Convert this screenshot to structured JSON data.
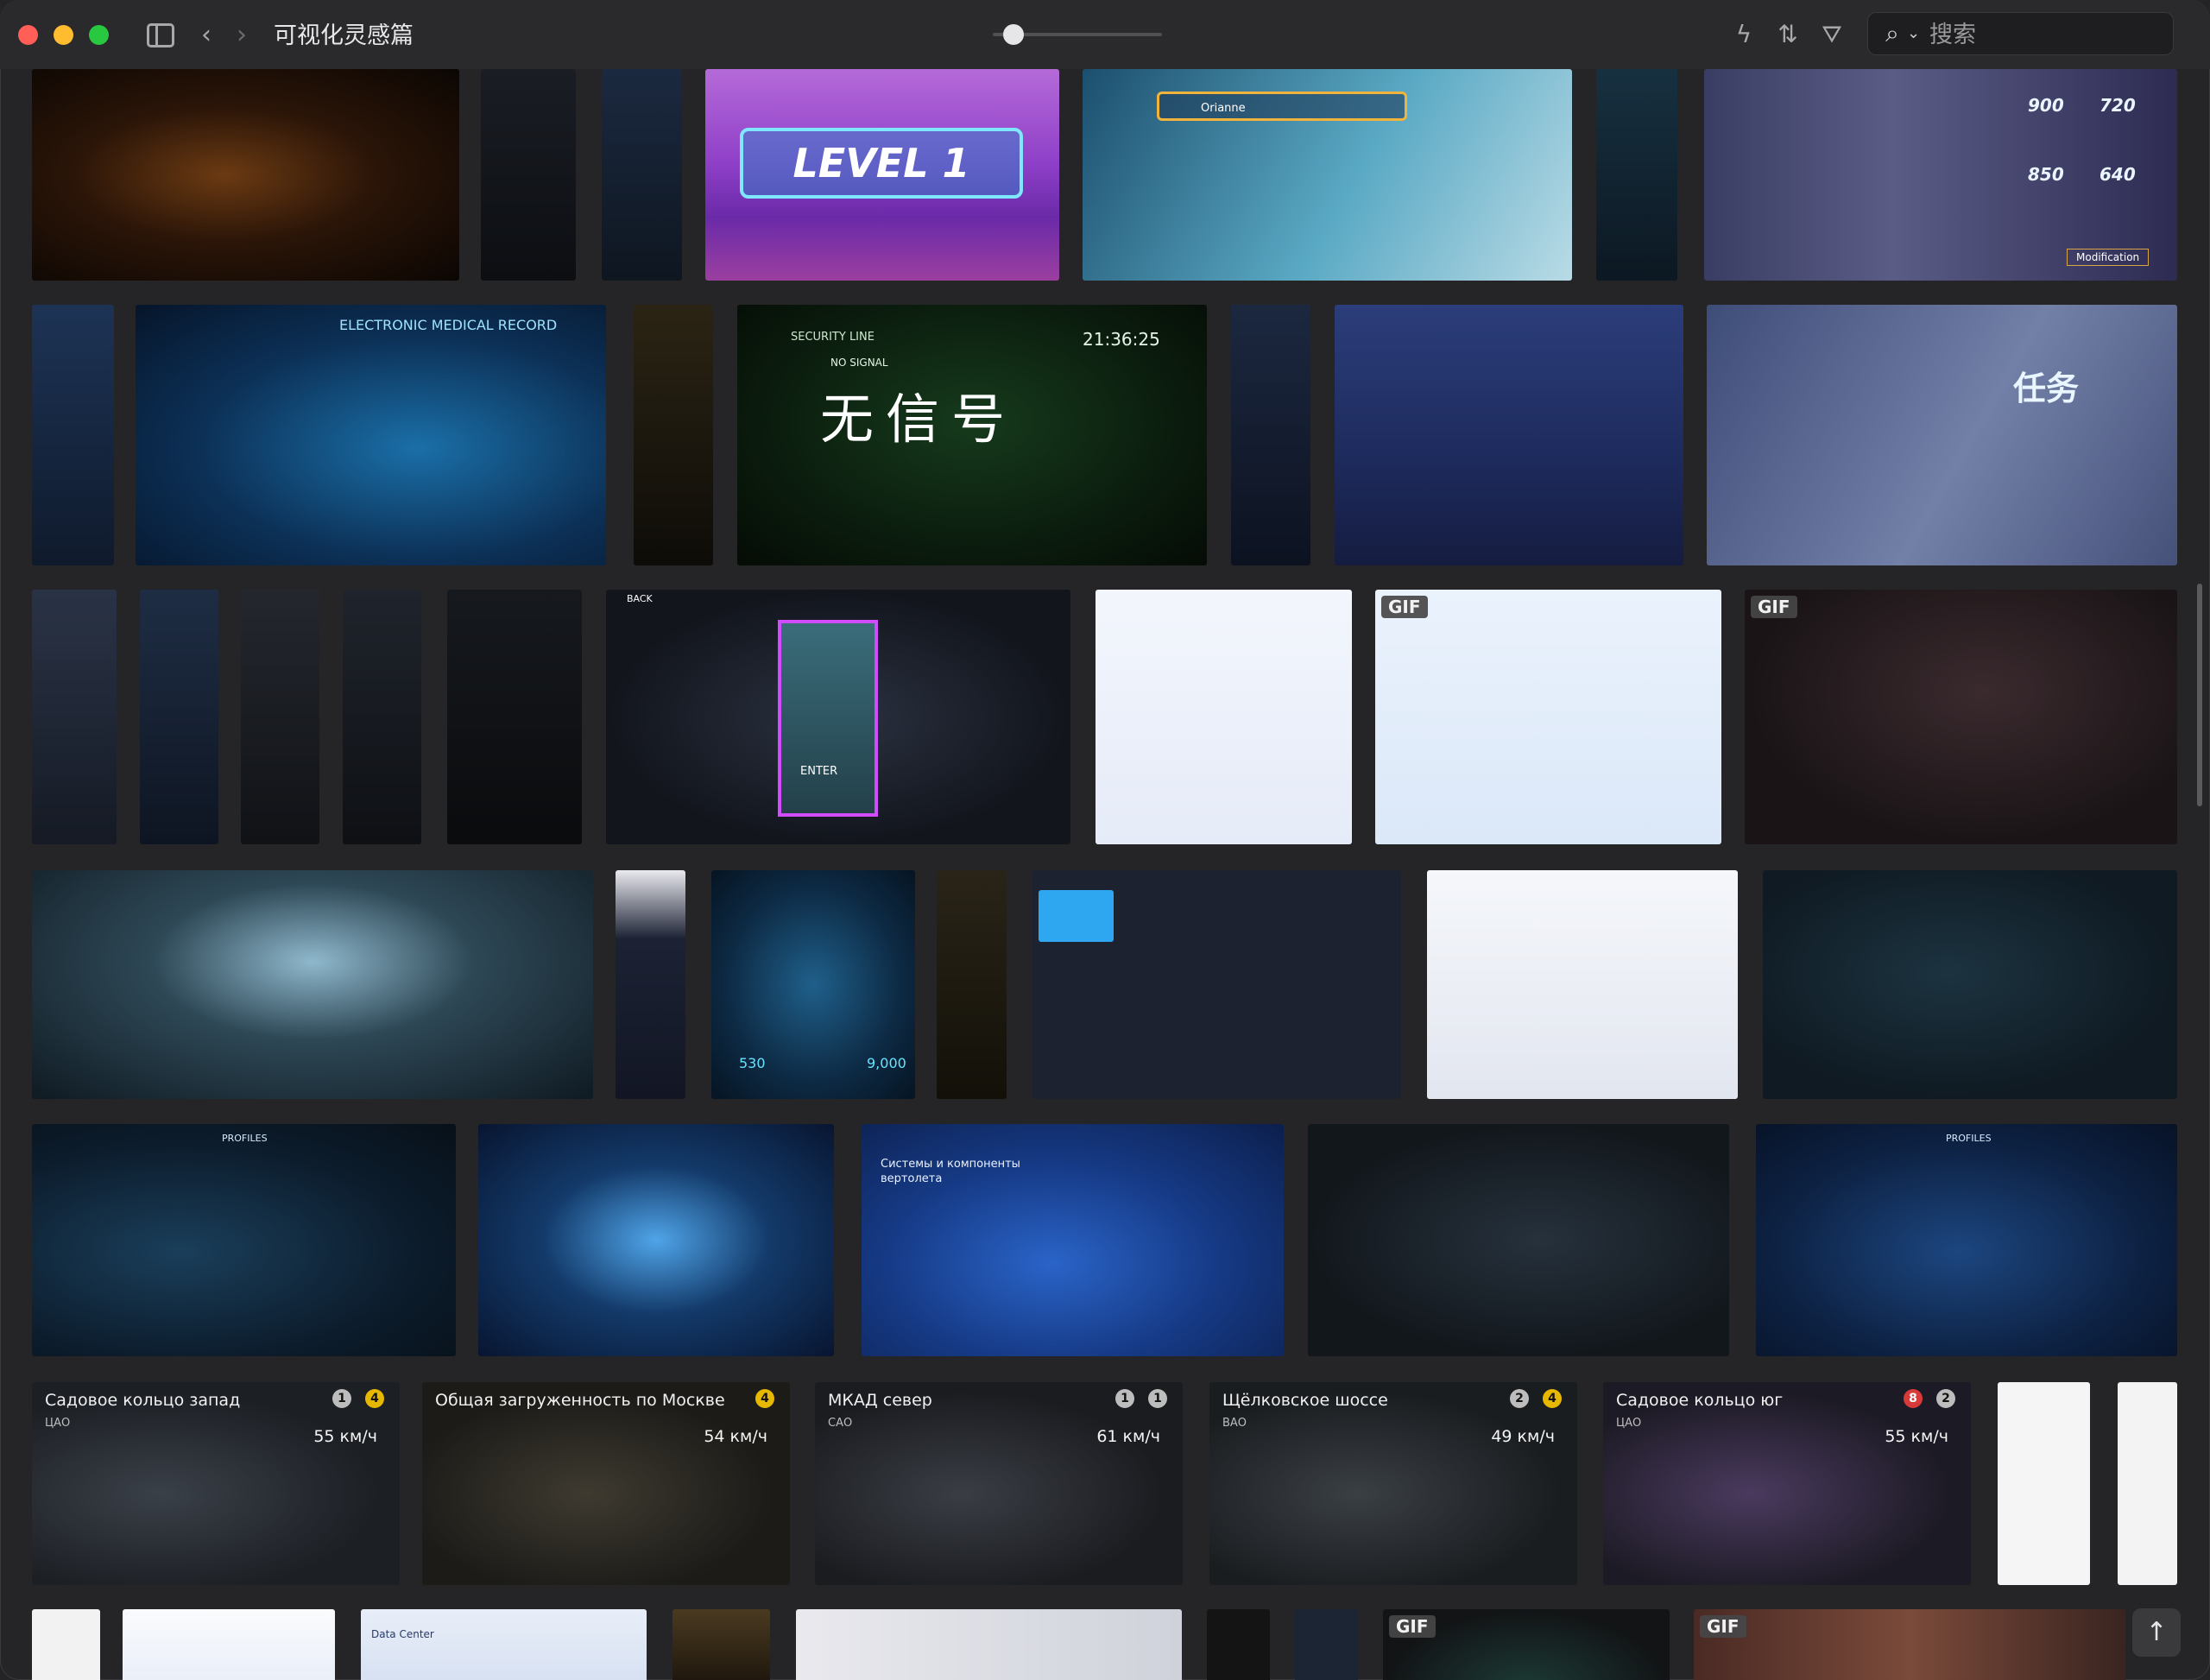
{
  "window": {
    "title": "可视化灵感篇"
  },
  "toolbar": {
    "back_icon": "‹",
    "forward_icon": "›",
    "flash_icon": "ϟ",
    "sort_icon": "⇅",
    "filter_icon": "⛛",
    "search_icon": "⌕",
    "search_chevron": "⌄",
    "search_placeholder": "搜索"
  },
  "tiles": {
    "level": "LEVEL  1",
    "medical": "ELECTRONIC MEDICAL RECORD",
    "security": "SECURITY LINE",
    "clock": "21:36:25",
    "nosignal": "NO SIGNAL",
    "nosignal_cn": "无信号",
    "renwu": "任务",
    "back": "BACK",
    "enter": "ENTER",
    "gif": "GIF",
    "heli": "Системы и компоненты вертолета",
    "profiles": "PROFILES",
    "orianne": "Orianne",
    "speed_900": "900",
    "speed_720": "720",
    "speed_850": "850",
    "speed_640": "640",
    "modification": "Modification",
    "datacenter": "Data Center",
    "n530": "530",
    "n9000": "9,000"
  },
  "maps": [
    {
      "title": "Садовое кольцо запад",
      "district": "ЦАО",
      "speed": "55 км/ч",
      "b1": "1",
      "b2": "4"
    },
    {
      "title": "Общая загруженность по Москве",
      "district": "",
      "speed": "54 км/ч",
      "b1": "",
      "b2": "4"
    },
    {
      "title": "МКАД север",
      "district": "САО",
      "speed": "61 км/ч",
      "b1": "1",
      "b2": "1"
    },
    {
      "title": "Щёлковское шоссе",
      "district": "ВАО",
      "speed": "49 км/ч",
      "b1": "2",
      "b2": "4"
    },
    {
      "title": "Садовое кольцо юг",
      "district": "ЦАО",
      "speed": "55 км/ч",
      "b1": "8",
      "b2": "2"
    }
  ],
  "scroll_top_icon": "↑",
  "colors": {
    "window_bg": "#252527",
    "titlebar_bg": "#2a2a2c",
    "accent_cyan": "#39c6ff"
  }
}
